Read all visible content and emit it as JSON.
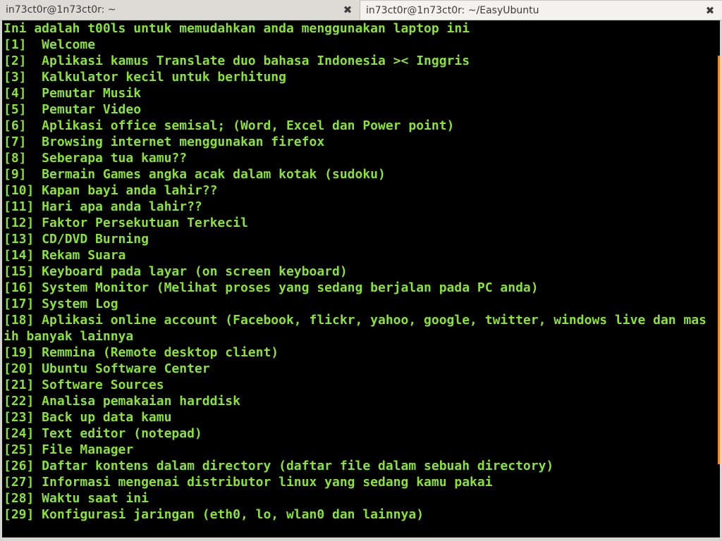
{
  "tabs": [
    {
      "title": "in73ct0r@1n73ct0r: ~",
      "close": "✖"
    },
    {
      "title": "in73ct0r@1n73ct0r: ~/EasyUbuntu",
      "close": "✖"
    }
  ],
  "terminal": {
    "fg_color": "#8ae234",
    "bg_color": "#000000",
    "lines": [
      "Ini adalah t00ls untuk memudahkan anda menggunakan laptop ini",
      "[1]  Welcome",
      "[2]  Aplikasi kamus Translate duo bahasa Indonesia >< Inggris",
      "[3]  Kalkulator kecil untuk berhitung",
      "[4]  Pemutar Musik",
      "[5]  Pemutar Video",
      "[6]  Aplikasi office semisal; (Word, Excel dan Power point)",
      "[7]  Browsing internet menggunakan firefox",
      "[8]  Seberapa tua kamu??",
      "[9]  Bermain Games angka acak dalam kotak (sudoku)",
      "[10] Kapan bayi anda lahir??",
      "[11] Hari apa anda lahir??",
      "[12] Faktor Persekutuan Terkecil",
      "[13] CD/DVD Burning",
      "[14] Rekam Suara",
      "[15] Keyboard pada layar (on screen keyboard)",
      "[16] System Monitor (Melihat proses yang sedang berjalan pada PC anda)",
      "[17] System Log",
      "[18] Aplikasi online account (Facebook, flickr, yahoo, google, twitter, windows live dan mas",
      "ih banyak lainnya",
      "[19] Remmina (Remote desktop client)",
      "[20] Ubuntu Software Center",
      "[21] Software Sources",
      "[22] Analisa pemakaian harddisk",
      "[23] Back up data kamu",
      "[24] Text editor (notepad)",
      "[25] File Manager",
      "[26] Daftar kontens dalam directory (daftar file dalam sebuah directory)",
      "[27] Informasi mengenai distributor linux yang sedang kamu pakai",
      "[28] Waktu saat ini",
      "[29] Konfigurasi jaringan (eth0, lo, wlan0 dan lainnya)"
    ]
  }
}
